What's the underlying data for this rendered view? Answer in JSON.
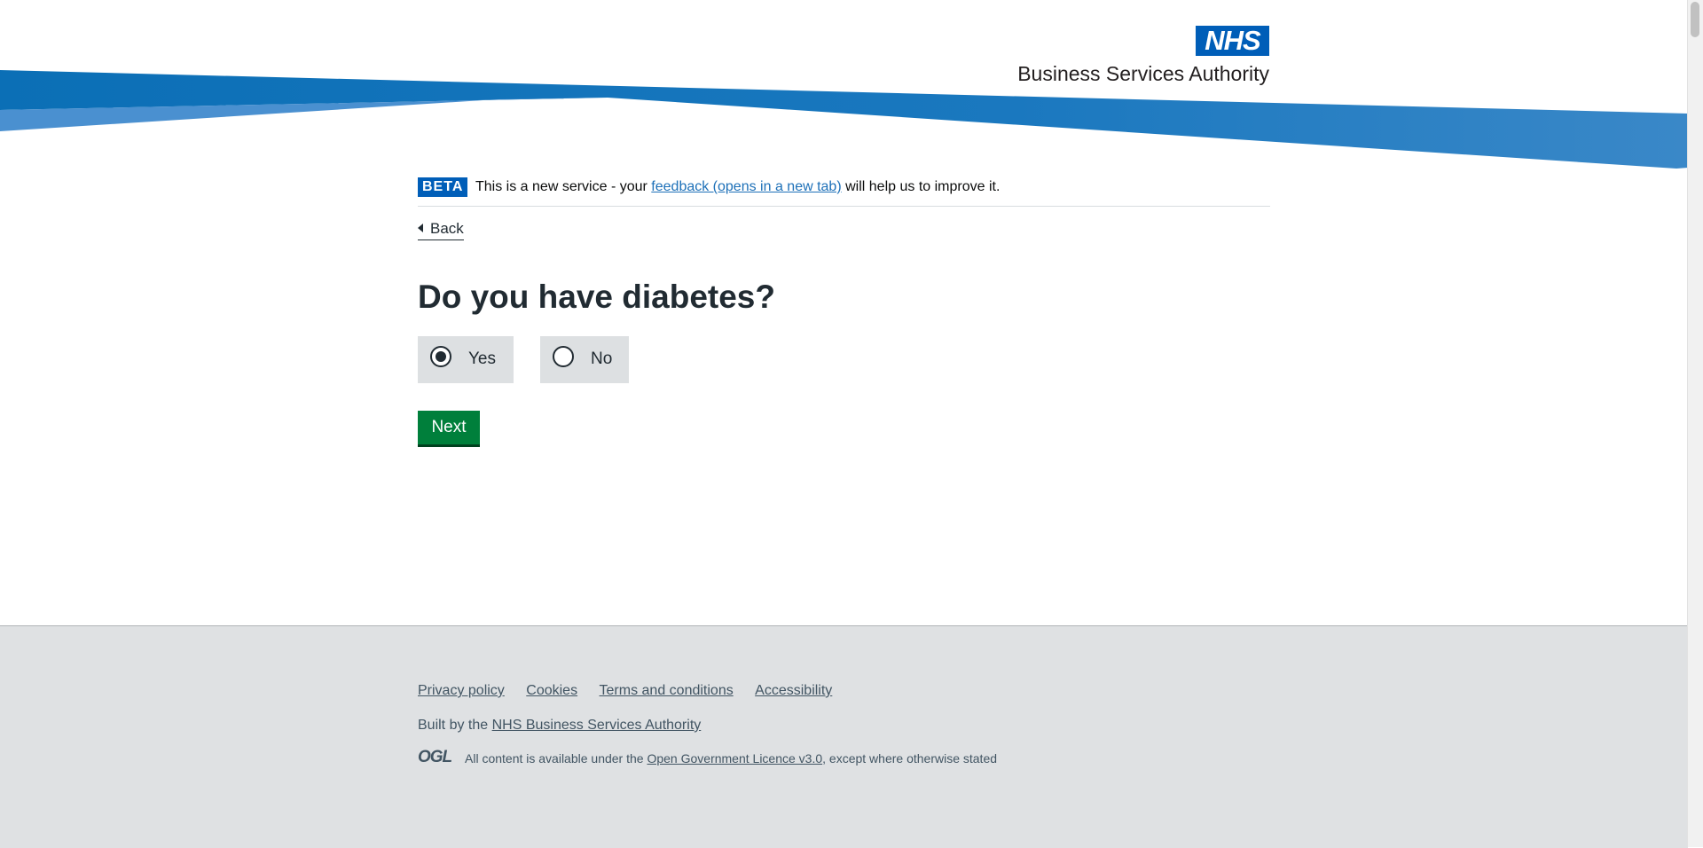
{
  "header": {
    "logo_mark": "NHS",
    "org_name": "Business Services Authority"
  },
  "phase_banner": {
    "tag": "BETA",
    "text_before": "This is a new service - your",
    "link_text": "feedback (opens in a new tab)",
    "text_after": "will help us to improve it."
  },
  "back_link": {
    "label": "Back"
  },
  "question": {
    "heading": "Do you have diabetes?",
    "options": [
      {
        "label": "Yes",
        "checked": true
      },
      {
        "label": "No",
        "checked": false
      }
    ]
  },
  "next_button": {
    "label": "Next"
  },
  "footer": {
    "links": [
      "Privacy policy",
      "Cookies",
      "Terms and conditions",
      "Accessibility"
    ],
    "built_by_text": "Built by the",
    "built_by_link": "NHS Business Services Authority",
    "ogl_logo": "OGL",
    "licence_before": "All content is available under the",
    "licence_link": "Open Government Licence v3.0",
    "licence_after": ", except where otherwise stated"
  },
  "colors": {
    "nhs_blue": "#005eb8",
    "band_light": "#4a90d0",
    "button_green": "#007f3b",
    "footer_bg": "#dfe1e3"
  }
}
